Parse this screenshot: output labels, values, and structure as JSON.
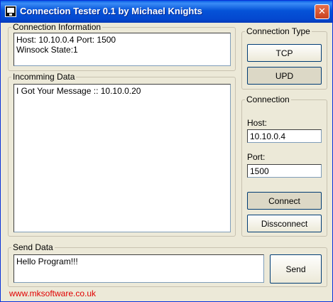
{
  "window": {
    "title": "Connection Tester 0.1 by Michael Knights"
  },
  "connection_info": {
    "legend": "Connection Information",
    "text": "Host: 10.10.0.4 Port: 1500\nWinsock State:1"
  },
  "incoming": {
    "legend": "Incomming Data",
    "text": "I Got Your Message :: 10.10.0.20"
  },
  "connection_type": {
    "legend": "Connection Type",
    "tcp_label": "TCP",
    "udp_label": "UPD"
  },
  "connection": {
    "legend": "Connection",
    "host_label": "Host:",
    "host_value": "10.10.0.4",
    "port_label": "Port:",
    "port_value": "1500",
    "connect_label": "Connect",
    "disconnect_label": "Dissconnect"
  },
  "send": {
    "legend": "Send Data",
    "text": "Hello Program!!!",
    "send_label": "Send"
  },
  "footer": {
    "link": "www.mksoftware.co.uk"
  },
  "colors": {
    "titlebar": "#0553d8",
    "close": "#c9411f",
    "link": "#e00000",
    "face": "#ece9d8"
  },
  "icons": {
    "app": "monitor-icon",
    "close": "close-icon"
  }
}
